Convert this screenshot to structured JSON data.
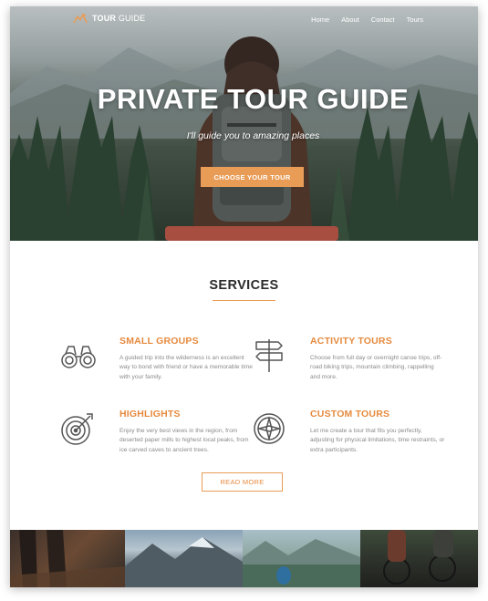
{
  "brand": {
    "logo_bold": "TOUR",
    "logo_light": " GUIDE"
  },
  "nav": {
    "items": [
      "Home",
      "About",
      "Contact",
      "Tours"
    ]
  },
  "hero": {
    "title": "PRIVATE TOUR GUIDE",
    "subtitle": "I'll guide you to amazing places",
    "cta": "CHOOSE YOUR TOUR"
  },
  "services": {
    "title": "SERVICES",
    "items": [
      {
        "icon": "binoculars-icon",
        "title": "SMALL GROUPS",
        "text": "A guided trip into the wilderness is an excellent way to bond with friend or have a memorable time with your family."
      },
      {
        "icon": "signpost-icon",
        "title": "ACTIVITY TOURS",
        "text": "Choose from full day or overnight canoe trips, off-road biking trips, mountain climbing, rappelling and more."
      },
      {
        "icon": "target-icon",
        "title": "HIGHLIGHTS",
        "text": "Enjoy the very best views in the region, from deserted paper mills to highest local peaks, from ice carved caves to ancient trees."
      },
      {
        "icon": "compass-icon",
        "title": "CUSTOM TOURS",
        "text": "Let me create a tour that fits you perfectly, adjusting for physical limitations, time restraints, or extra participants."
      }
    ],
    "read_more": "READ MORE"
  },
  "colors": {
    "accent": "#e89c56",
    "accent_text": "#e68a3e",
    "body_text": "#8a8a8a",
    "heading": "#2b2b2b"
  }
}
